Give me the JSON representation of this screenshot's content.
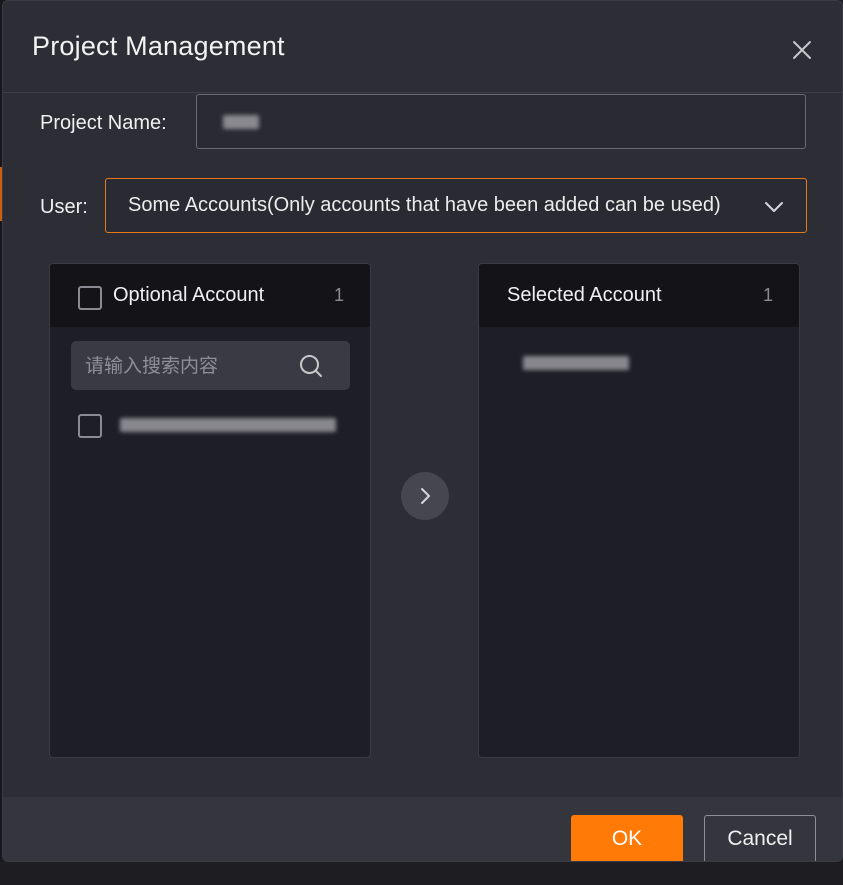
{
  "dialog": {
    "title": "Project Management"
  },
  "form": {
    "project_name_label": "Project Name:",
    "user_label": "User:",
    "user_selected_value": "Some Accounts(Only accounts that have been added can be used)"
  },
  "optional_panel": {
    "title": "Optional Account",
    "count": "1",
    "search_placeholder": "请输入搜索内容"
  },
  "selected_panel": {
    "title": "Selected Account",
    "count": "1"
  },
  "footer": {
    "ok_label": "OK",
    "cancel_label": "Cancel"
  },
  "colors": {
    "accent": "#ff7a06",
    "select_border": "#e8781a",
    "dialog_bg": "#2c2d35",
    "panel_bg": "#1e1e26"
  },
  "icons": {
    "close": "close-icon",
    "dropdown": "chevron-down-icon",
    "search": "search-icon",
    "transfer": "chevron-right-icon"
  }
}
